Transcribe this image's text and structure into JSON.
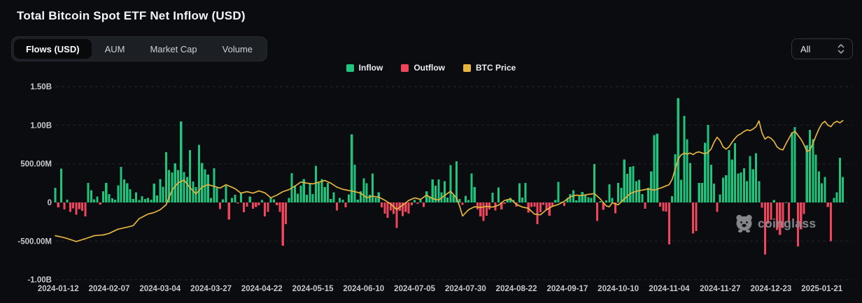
{
  "header": {
    "title": "Total Bitcoin Spot ETF Net Inflow (USD)"
  },
  "tabs": [
    {
      "label": "Flows (USD)",
      "active": true
    },
    {
      "label": "AUM",
      "active": false
    },
    {
      "label": "Market Cap",
      "active": false
    },
    {
      "label": "Volume",
      "active": false
    }
  ],
  "range_select": {
    "value": "All",
    "icon": "select-up-down-chevrons"
  },
  "legend": [
    {
      "label": "Inflow",
      "color": "#1fc47d"
    },
    {
      "label": "Outflow",
      "color": "#f0455c"
    },
    {
      "label": "BTC Price",
      "color": "#e5b53f"
    }
  ],
  "watermark": {
    "text": "coinglass",
    "icon": "coinglass-bear-logo"
  },
  "colors": {
    "background": "#0a0c0f",
    "grid": "#34373c",
    "axis_text": "#c6c9cd",
    "inflow": "#1fc47d",
    "outflow": "#f0455c",
    "btc_line": "#e5b53f"
  },
  "chart_data": {
    "type": "bar+line",
    "title": "Total Bitcoin Spot ETF Net Inflow (USD)",
    "unit": "values in USD millions (left axis: B = billions, M = millions)",
    "legend_position": "top-center",
    "grid": "horizontal dashed",
    "series": [
      {
        "name": "Inflow",
        "type": "bar",
        "color": "#1fc47d",
        "maps_to": "positive values of flows_musd"
      },
      {
        "name": "Outflow",
        "type": "bar",
        "color": "#f0455c",
        "maps_to": "negative values of flows_musd"
      },
      {
        "name": "BTC Price",
        "type": "line",
        "color": "#e5b53f",
        "axis": "hidden (no price labels shown; keypoints given on left-axis scale)"
      }
    ],
    "y_axis": {
      "tick_labels": [
        "1.50B",
        "1.00B",
        "500.00M",
        "0",
        "-500.00M",
        "-1.00B"
      ],
      "tick_values_musd": [
        1500,
        1000,
        500,
        0,
        -500,
        -1000
      ],
      "range_musd": [
        -1000,
        1500
      ]
    },
    "x_axis": {
      "tick_labels": [
        "2024-01-12",
        "2024-02-07",
        "2024-03-04",
        "2024-03-27",
        "2024-04-22",
        "2024-05-15",
        "2024-06-10",
        "2024-07-05",
        "2024-07-30",
        "2024-08-22",
        "2024-09-17",
        "2024-10-10",
        "2024-11-04",
        "2024-11-27",
        "2024-12-23",
        "2025-01-21"
      ],
      "tick_bar_indices": [
        1,
        18,
        35,
        52,
        69,
        86,
        103,
        120,
        137,
        154,
        171,
        188,
        205,
        222,
        239,
        256
      ]
    },
    "flows_musd": [
      190,
      -65,
      440,
      -90,
      35,
      -120,
      -75,
      -160,
      -85,
      -110,
      -180,
      255,
      160,
      40,
      75,
      -25,
      145,
      255,
      110,
      55,
      35,
      220,
      460,
      300,
      250,
      170,
      45,
      130,
      30,
      80,
      45,
      60,
      35,
      245,
      90,
      305,
      205,
      650,
      420,
      390,
      505,
      420,
      1050,
      395,
      330,
      680,
      270,
      200,
      745,
      510,
      430,
      360,
      60,
      445,
      190,
      -85,
      40,
      215,
      -220,
      60,
      100,
      -15,
      125,
      -125,
      -55,
      75,
      -80,
      -60,
      -35,
      30,
      -180,
      -120,
      60,
      40,
      -35,
      -120,
      -560,
      -280,
      60,
      380,
      220,
      115,
      215,
      305,
      100,
      250,
      110,
      475,
      255,
      305,
      200,
      255,
      45,
      130,
      -105,
      60,
      35,
      -65,
      105,
      880,
      490,
      35,
      145,
      310,
      250,
      100,
      375,
      65,
      130,
      -65,
      -145,
      -200,
      -105,
      -150,
      -330,
      -110,
      -175,
      -120,
      -145,
      -35,
      30,
      -20,
      45,
      -60,
      145,
      75,
      300,
      215,
      300,
      130,
      275,
      65,
      485,
      95,
      535,
      45,
      -30,
      85,
      30,
      375,
      200,
      -90,
      -180,
      -240,
      -170,
      -90,
      125,
      -105,
      195,
      -90,
      -20,
      35,
      60,
      30,
      -55,
      250,
      65,
      255,
      -130,
      -60,
      -55,
      -280,
      -125,
      -30,
      -100,
      -170,
      -55,
      30,
      265,
      10,
      -45,
      60,
      110,
      160,
      25,
      90,
      135,
      105,
      70,
      60,
      495,
      -240,
      20,
      -95,
      25,
      235,
      60,
      -140,
      255,
      190,
      555,
      370,
      460,
      470,
      275,
      295,
      110,
      -80,
      190,
      400,
      870,
      890,
      -55,
      -115,
      -116,
      -540,
      80,
      622,
      1350,
      293,
      1120,
      818,
      510,
      -400,
      -370,
      255,
      254,
      773,
      1005,
      490,
      245,
      -122,
      103,
      320,
      354,
      676,
      557,
      766,
      377,
      390,
      443,
      275,
      599,
      430,
      636,
      275,
      -68,
      -672,
      -277,
      -226,
      31,
      -358,
      -420,
      -330,
      5,
      -250,
      908,
      978,
      -569,
      -350,
      -149,
      740,
      940,
      820,
      620,
      400,
      250,
      330,
      -60,
      -500,
      60,
      130,
      580,
      330
    ],
    "btc_price_line": {
      "keypoints_musd_scale": [
        [
          0,
          -430
        ],
        [
          3,
          -455
        ],
        [
          7,
          -505
        ],
        [
          10,
          -470
        ],
        [
          13,
          -430
        ],
        [
          16,
          -420
        ],
        [
          18,
          -400
        ],
        [
          21,
          -345
        ],
        [
          24,
          -320
        ],
        [
          26,
          -300
        ],
        [
          28,
          -210
        ],
        [
          31,
          -150
        ],
        [
          33,
          -130
        ],
        [
          35,
          -95
        ],
        [
          37,
          -30
        ],
        [
          39,
          160
        ],
        [
          41,
          255
        ],
        [
          43,
          290
        ],
        [
          45,
          190
        ],
        [
          47,
          110
        ],
        [
          49,
          200
        ],
        [
          51,
          230
        ],
        [
          53,
          210
        ],
        [
          55,
          185
        ],
        [
          57,
          230
        ],
        [
          60,
          180
        ],
        [
          62,
          120
        ],
        [
          64,
          140
        ],
        [
          66,
          120
        ],
        [
          68,
          150
        ],
        [
          70,
          125
        ],
        [
          72,
          60
        ],
        [
          74,
          95
        ],
        [
          76,
          140
        ],
        [
          78,
          165
        ],
        [
          80,
          210
        ],
        [
          82,
          265
        ],
        [
          84,
          250
        ],
        [
          86,
          240
        ],
        [
          88,
          262
        ],
        [
          90,
          285
        ],
        [
          92,
          250
        ],
        [
          94,
          200
        ],
        [
          96,
          170
        ],
        [
          98,
          155
        ],
        [
          100,
          140
        ],
        [
          102,
          120
        ],
        [
          104,
          62
        ],
        [
          106,
          80
        ],
        [
          108,
          70
        ],
        [
          110,
          30
        ],
        [
          112,
          -20
        ],
        [
          114,
          -90
        ],
        [
          116,
          -35
        ],
        [
          118,
          25
        ],
        [
          120,
          60
        ],
        [
          122,
          40
        ],
        [
          124,
          95
        ],
        [
          126,
          50
        ],
        [
          128,
          30
        ],
        [
          130,
          90
        ],
        [
          132,
          145
        ],
        [
          134,
          60
        ],
        [
          135,
          -45
        ],
        [
          136,
          -175
        ],
        [
          138,
          -95
        ],
        [
          140,
          -55
        ],
        [
          142,
          -65
        ],
        [
          144,
          -50
        ],
        [
          146,
          -60
        ],
        [
          148,
          -35
        ],
        [
          150,
          25
        ],
        [
          152,
          45
        ],
        [
          154,
          -25
        ],
        [
          156,
          -60
        ],
        [
          158,
          -75
        ],
        [
          160,
          -150
        ],
        [
          162,
          -160
        ],
        [
          164,
          -95
        ],
        [
          166,
          -50
        ],
        [
          168,
          -25
        ],
        [
          170,
          15
        ],
        [
          172,
          75
        ],
        [
          174,
          95
        ],
        [
          176,
          90
        ],
        [
          178,
          105
        ],
        [
          180,
          115
        ],
        [
          182,
          45
        ],
        [
          184,
          -45
        ],
        [
          185,
          -55
        ],
        [
          186,
          -5
        ],
        [
          188,
          -30
        ],
        [
          190,
          45
        ],
        [
          192,
          115
        ],
        [
          194,
          145
        ],
        [
          196,
          160
        ],
        [
          198,
          175
        ],
        [
          200,
          160
        ],
        [
          202,
          185
        ],
        [
          204,
          215
        ],
        [
          205,
          230
        ],
        [
          206,
          300
        ],
        [
          207,
          430
        ],
        [
          208,
          560
        ],
        [
          209,
          615
        ],
        [
          210,
          640
        ],
        [
          211,
          625
        ],
        [
          212,
          640
        ],
        [
          213,
          620
        ],
        [
          214,
          645
        ],
        [
          215,
          655
        ],
        [
          216,
          640
        ],
        [
          217,
          630
        ],
        [
          218,
          650
        ],
        [
          219,
          690
        ],
        [
          220,
          780
        ],
        [
          221,
          845
        ],
        [
          222,
          800
        ],
        [
          223,
          720
        ],
        [
          224,
          690
        ],
        [
          225,
          720
        ],
        [
          226,
          780
        ],
        [
          227,
          830
        ],
        [
          228,
          870
        ],
        [
          229,
          890
        ],
        [
          230,
          920
        ],
        [
          231,
          940
        ],
        [
          232,
          930
        ],
        [
          233,
          950
        ],
        [
          234,
          980
        ],
        [
          235,
          1055
        ],
        [
          236,
          900
        ],
        [
          237,
          820
        ],
        [
          238,
          850
        ],
        [
          239,
          830
        ],
        [
          240,
          790
        ],
        [
          241,
          720
        ],
        [
          242,
          690
        ],
        [
          243,
          680
        ],
        [
          244,
          760
        ],
        [
          245,
          830
        ],
        [
          246,
          900
        ],
        [
          247,
          920
        ],
        [
          248,
          870
        ],
        [
          249,
          820
        ],
        [
          250,
          750
        ],
        [
          251,
          660
        ],
        [
          252,
          680
        ],
        [
          253,
          760
        ],
        [
          254,
          860
        ],
        [
          255,
          950
        ],
        [
          256,
          1020
        ],
        [
          257,
          1050
        ],
        [
          258,
          1000
        ],
        [
          259,
          980
        ],
        [
          260,
          1030
        ],
        [
          261,
          1050
        ],
        [
          262,
          1030
        ],
        [
          263,
          1060
        ]
      ]
    }
  }
}
